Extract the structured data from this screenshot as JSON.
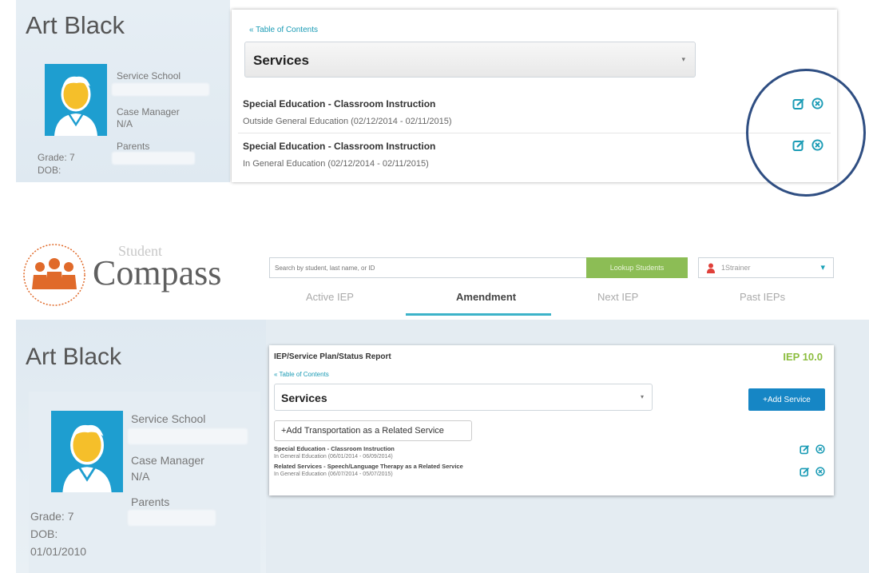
{
  "top_view": {
    "student_name": "Art Black",
    "labels": {
      "service_school": "Service School",
      "case_manager": "Case Manager",
      "case_manager_value": "N/A",
      "parents": "Parents",
      "grade": "Grade: 7",
      "dob": "DOB:"
    },
    "toc_link": "« Table of Contents",
    "section_select": "Services",
    "services": [
      {
        "title": "Special Education - Classroom Instruction",
        "detail": "Outside General Education (02/12/2014 - 02/11/2015)"
      },
      {
        "title": "Special Education - Classroom Instruction",
        "detail": "In General Education (02/12/2014 - 02/11/2015)"
      }
    ]
  },
  "bottom_view": {
    "logo": {
      "student": "Student",
      "compass": "Compass"
    },
    "search": {
      "placeholder": "Search by student, last name, or ID"
    },
    "lookup_button": "Lookup Students",
    "user": {
      "name": "1Strainer"
    },
    "tabs": [
      {
        "label": "Active IEP",
        "active": false
      },
      {
        "label": "Amendment",
        "active": true
      },
      {
        "label": "Next IEP",
        "active": false
      },
      {
        "label": "Past IEPs",
        "active": false
      }
    ],
    "student_name": "Art Black",
    "labels": {
      "service_school": "Service School",
      "case_manager": "Case Manager",
      "case_manager_value": "N/A",
      "parents": "Parents",
      "grade": "Grade: 7",
      "dob": "DOB:",
      "dob_value": "01/01/2010"
    },
    "card": {
      "title": "IEP/Service Plan/Status Report",
      "iep_version": "IEP 10.0",
      "toc_link": "« Table of Contents",
      "section_select": "Services",
      "add_service": "+Add Service",
      "add_transport": "+Add Transportation as a Related Service",
      "services": [
        {
          "title": "Special Education - Classroom Instruction",
          "detail": "In General Education (06/01/2014 - 06/09/2014)"
        },
        {
          "title": "Related Services - Speech/Language Therapy as a Related Service",
          "detail": "In General Education (06/07/2014 - 05/07/2015)"
        }
      ]
    }
  },
  "colors": {
    "accent_teal": "#1a9bb5",
    "avatar_blue": "#1e9ed0",
    "lookup_green": "#8cbd55",
    "add_service_blue": "#1686c5",
    "iep_green": "#8cbd3f",
    "highlight_navy": "#2f4e82"
  },
  "icons": [
    "edit-icon",
    "remove-icon",
    "user-icon",
    "student-avatar-icon",
    "logo-figures-icon"
  ]
}
